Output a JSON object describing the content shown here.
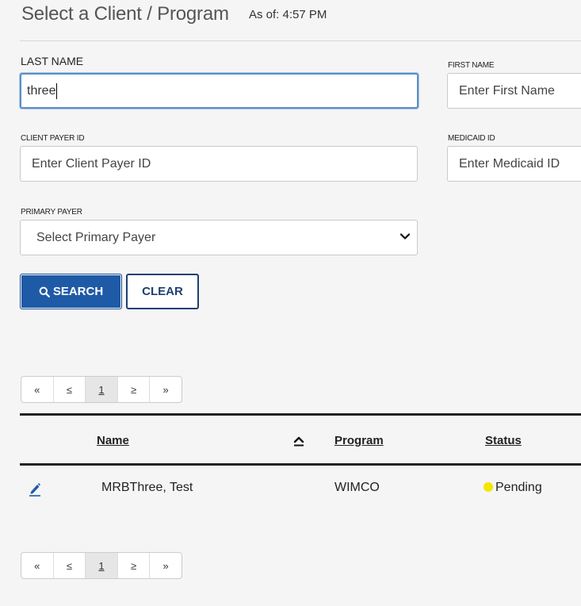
{
  "header": {
    "title": "Select a Client / Program",
    "as_of": "As of: 4:57 PM"
  },
  "form": {
    "last_name": {
      "label": "LAST NAME",
      "value": "three",
      "placeholder": ""
    },
    "first_name": {
      "label": "FIRST NAME",
      "value": "",
      "placeholder": "Enter First Name"
    },
    "client_payer_id": {
      "label": "CLIENT PAYER ID",
      "value": "",
      "placeholder": "Enter Client Payer ID"
    },
    "medicaid_id": {
      "label": "MEDICAID ID",
      "value": "",
      "placeholder": "Enter Medicaid ID"
    },
    "primary_payer": {
      "label": "PRIMARY PAYER",
      "selected": "Select Primary Payer"
    }
  },
  "buttons": {
    "search": "SEARCH",
    "clear": "CLEAR"
  },
  "pager": {
    "first": "«",
    "prev": "≤",
    "current": "1",
    "next": "≥",
    "last": "»"
  },
  "grid": {
    "columns": {
      "name": "Name",
      "program": "Program",
      "status": "Status"
    },
    "rows": [
      {
        "name": "MRBThree, Test",
        "program": "WIMCO",
        "status": "Pending",
        "status_color": "#f2e600"
      }
    ]
  },
  "colors": {
    "primary_button": "#1f5aa6",
    "clear_button_border": "#1f3f73",
    "focus_border": "#5b8ec6",
    "pending": "#f2e600"
  }
}
